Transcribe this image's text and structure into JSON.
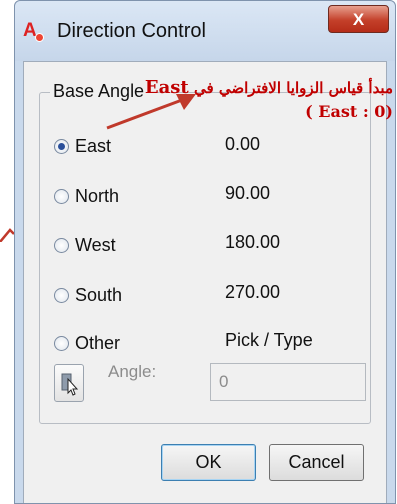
{
  "window": {
    "title": "Direction Control",
    "close_label": "X"
  },
  "group": {
    "label": "Base Angle",
    "options": [
      {
        "label": "East",
        "value": "0.00",
        "checked": true
      },
      {
        "label": "North",
        "value": "90.00",
        "checked": false
      },
      {
        "label": "West",
        "value": "180.00",
        "checked": false
      },
      {
        "label": "South",
        "value": "270.00",
        "checked": false
      },
      {
        "label": "Other",
        "value": "Pick / Type",
        "checked": false
      }
    ],
    "angle_label": "Angle:",
    "angle_value": "0"
  },
  "buttons": {
    "ok": "OK",
    "cancel": "Cancel"
  },
  "annotation": {
    "line1_arabic": "مبدأ قياس الزوايا الافتراضي في",
    "line1_english": "East",
    "line2": "( East : 0)",
    "color": "#c00000"
  },
  "icons": {
    "app": "autocad-app-icon",
    "pick": "pick-point-cursor-icon",
    "annotation_arrow": "red-arrow-icon"
  }
}
